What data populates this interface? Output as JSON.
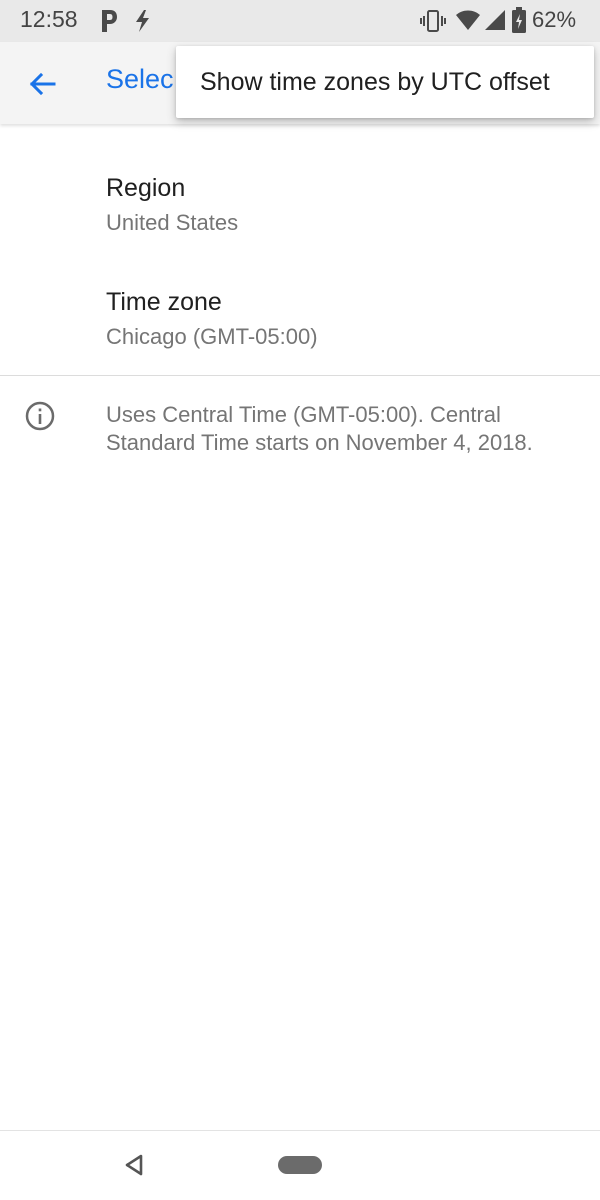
{
  "status_bar": {
    "time": "12:58",
    "battery_percent": "62%",
    "icons": [
      "p-notification-icon",
      "bolt-notification-icon",
      "vibrate-icon",
      "wifi-icon",
      "cell-signal-icon",
      "battery-charging-icon"
    ]
  },
  "app_bar": {
    "title": "Select time zone",
    "title_visible": "Selec",
    "accent_color": "#1a73e8"
  },
  "overflow_menu": {
    "items": [
      {
        "label": "Show time zones by UTC offset"
      }
    ]
  },
  "preferences": {
    "region": {
      "title": "Region",
      "summary": "United States"
    },
    "time_zone": {
      "title": "Time zone",
      "summary": "Chicago (GMT-05:00)"
    }
  },
  "info": {
    "text": "Uses Central Time (GMT-05:00). Central Standard Time starts on November 4, 2018."
  },
  "nav_bar": {
    "icons": [
      "back-triangle-icon",
      "home-pill-icon"
    ]
  }
}
